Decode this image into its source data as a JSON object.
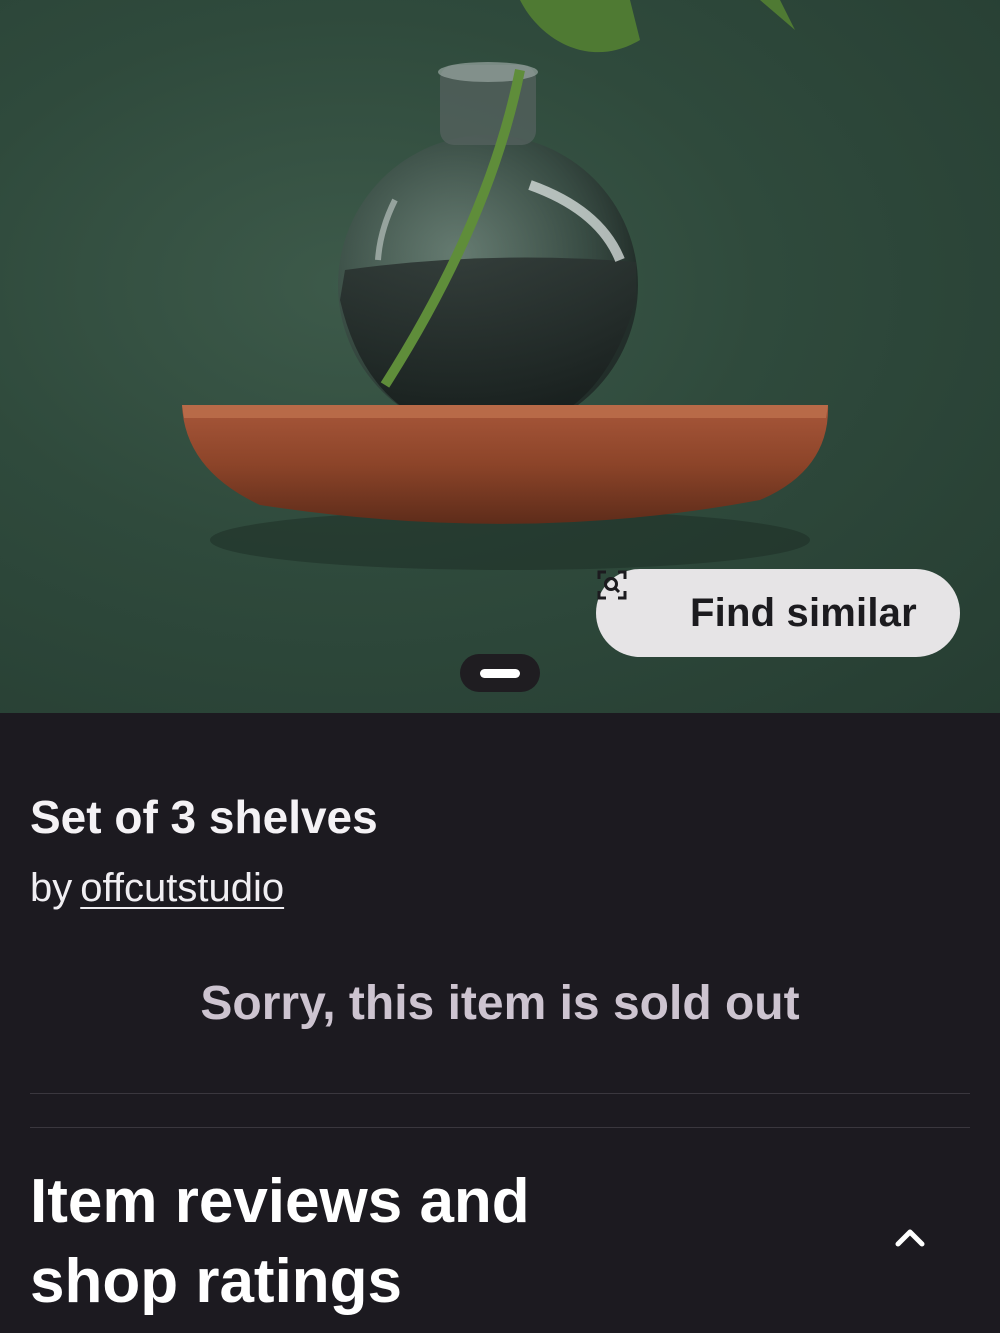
{
  "product": {
    "image_description_icon": "product-photo",
    "find_similar_label": "Find similar",
    "title": "Set of 3 shelves",
    "by_prefix": "by",
    "shop_name": "offcutstudio",
    "status_message": "Sorry, this item is sold out"
  },
  "reviews": {
    "heading": "Item reviews and shop ratings",
    "toggle_icon": "chevron-up-icon"
  },
  "colors": {
    "background": "#1c1a20",
    "hero_green": "#2f4a3c",
    "button_bg": "#e6e4e6",
    "soldout_text": "#cdc4d0"
  }
}
